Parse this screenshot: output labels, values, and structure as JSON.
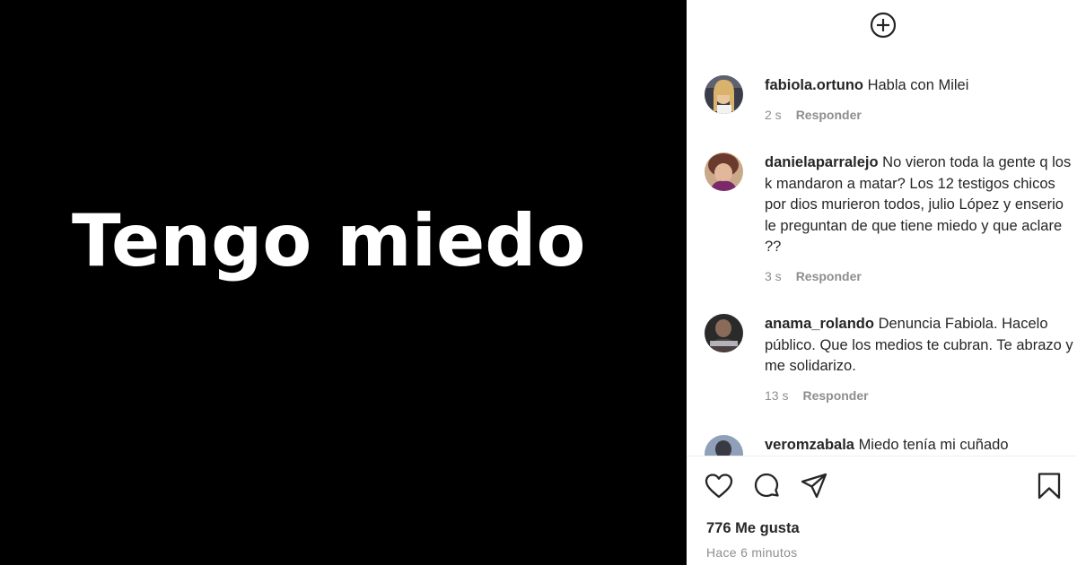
{
  "media": {
    "text": "Tengo miedo"
  },
  "comments": [
    {
      "username": "fabiola.ortuno",
      "text": "Habla con Milei",
      "time": "2 s",
      "reply_label": "Responder"
    },
    {
      "username": "danielaparralejo",
      "text": "No vieron toda la gente q los k mandaron a matar? Los 12 testigos chicos por dios murieron todos, julio López y enserio le preguntan de que tiene miedo y que aclare ??",
      "time": "3 s",
      "reply_label": "Responder"
    },
    {
      "username": "anama_rolando",
      "text": "Denuncia Fabiola. Hacelo público. Que los medios te cubran. Te abrazo y me solidarizo.",
      "time": "13 s",
      "reply_label": "Responder"
    },
    {
      "username": "veromzabala",
      "text": "Miedo tenía mi cuñado"
    }
  ],
  "actions": [
    "heart-icon",
    "comment-icon",
    "share-icon",
    "bookmark-icon"
  ],
  "likes": "776 Me gusta",
  "posted": "Hace 6 minutos",
  "colors": {
    "media_bg": "#000000",
    "text_primary": "#262626",
    "text_secondary": "#8e8e8e"
  }
}
